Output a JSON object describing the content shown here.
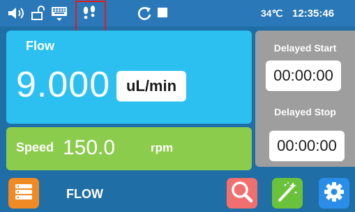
{
  "status": {
    "temperature": "34℃",
    "time": "12:35:46"
  },
  "flow": {
    "title": "Flow",
    "value": "9.000",
    "unit": "uL/min"
  },
  "speed": {
    "label": "Speed",
    "value": "150.0",
    "unit": "rpm"
  },
  "delay": {
    "start_label": "Delayed Start",
    "start_time": "00:00:00",
    "stop_label": "Delayed Stop",
    "stop_time": "00:00:00"
  },
  "bottom": {
    "mode_label": "FLOW"
  },
  "icons": {
    "status": [
      "speaker-icon",
      "unlock-icon",
      "keyboard-icon",
      "footprints-icon",
      "refresh-icon",
      "stop-icon"
    ],
    "bottom": [
      "menu-icon",
      "search-icon",
      "magic-wand-icon",
      "gear-icon"
    ]
  },
  "colors": {
    "flow_panel": "#2bc0f0",
    "speed_panel": "#8ccc4d",
    "delay_panel": "#9e9e9e",
    "menu_button": "#f08a24",
    "search_button": "#f16f6f",
    "wand_button": "#6ac23a",
    "gear_button": "#2a8ee8",
    "highlight": "#e01b1b"
  }
}
